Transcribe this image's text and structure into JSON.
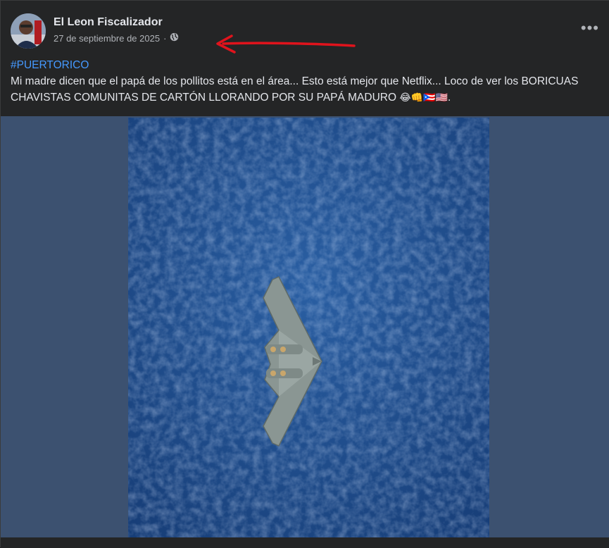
{
  "post": {
    "author": "El Leon Fiscalizador",
    "date": "27 de septiembre de 2025",
    "separator": "·",
    "privacy_icon": "globe-icon",
    "more_label": "•••",
    "hashtag": "#PUERTORICO",
    "body": "Mi madre dicen que el papá de los pollitos está en el área... Esto está mejor que Netflix... Loco de ver los BORICUAS CHAVISTAS COMUNITAS DE CARTÓN LLORANDO POR SU PAPÁ MADURO",
    "emojis": [
      "😂",
      "👊",
      "🇵🇷",
      "🇺🇸"
    ],
    "trailing": "."
  },
  "annotation": {
    "icon": "red-arrow-annotation",
    "color": "#e0131c"
  },
  "colors": {
    "card_bg": "#242526",
    "media_bg": "#3c5170",
    "ocean": "#1e4a8c",
    "link": "#4599ff"
  }
}
